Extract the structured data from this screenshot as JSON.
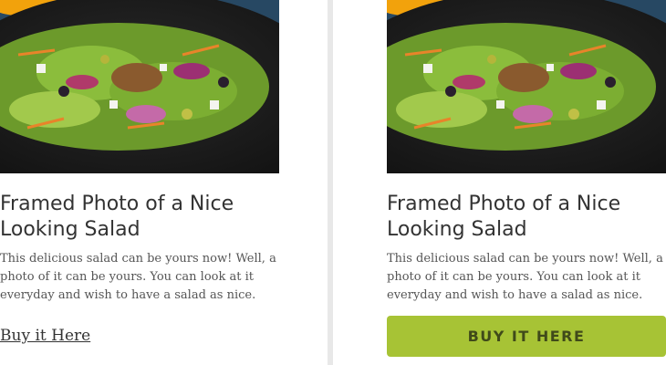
{
  "cards": [
    {
      "title": "Framed Photo of a Nice Looking Salad",
      "description": "This delicious salad can be yours now!  Well, a photo of it can be yours.  You can look at it everyday and wish to have a salad as nice.",
      "action_label": "Buy it Here",
      "action_style": "link"
    },
    {
      "title": "Framed Photo of a Nice Looking Salad",
      "description": "This delicious salad can be yours now!  Well, a photo of it can be yours.  You can look at it everyday and wish to have a salad as nice.",
      "action_label": "BUY IT HERE",
      "action_style": "button"
    }
  ],
  "colors": {
    "button_background": "#a7c335",
    "button_text": "#404a1a",
    "divider": "#e8e8e8"
  }
}
